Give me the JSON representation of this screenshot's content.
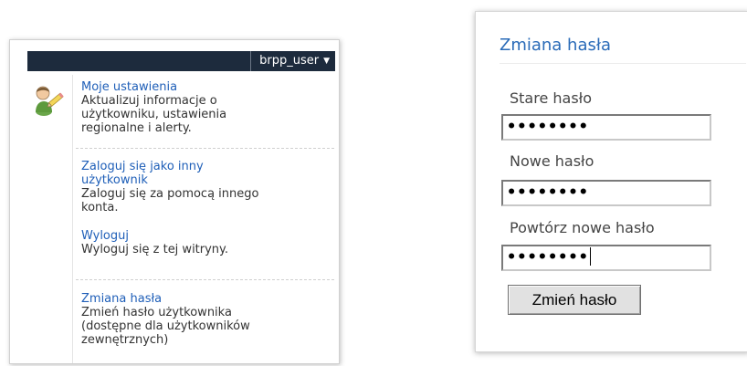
{
  "menu": {
    "user_name": "brpp_user",
    "icon": "user-edit-icon",
    "items": [
      {
        "title_lines": [
          "Moje ustawienia"
        ],
        "desc_lines": [
          "Aktualizuj informacje o",
          "użytkowniku, ustawienia",
          "regionalne i alerty."
        ]
      },
      {
        "title_lines": [
          "Zaloguj się jako inny",
          "użytkownik"
        ],
        "desc_lines": [
          "Zaloguj się za pomocą innego",
          "konta."
        ]
      },
      {
        "title_lines": [
          "Wyloguj"
        ],
        "desc_lines": [
          "Wyloguj się z tej witryny."
        ]
      },
      {
        "title_lines": [
          "Zmiana hasła"
        ],
        "desc_lines": [
          "Zmień hasło użytkownika",
          "(dostępne dla użytkowników",
          "zewnętrznych)"
        ]
      }
    ]
  },
  "password_dialog": {
    "title": "Zmiana hasła",
    "old_label": "Stare hasło",
    "old_value": "••••••••",
    "new_label": "Nowe hasło",
    "new_value": "••••••••",
    "repeat_label": "Powtórz nowe hasło",
    "repeat_value": "••••••••",
    "submit_label": "Zmień hasło"
  },
  "colors": {
    "user_bar": "#1d2b3d",
    "link": "#1f5fb8",
    "dialog_title": "#2a6bb8"
  }
}
